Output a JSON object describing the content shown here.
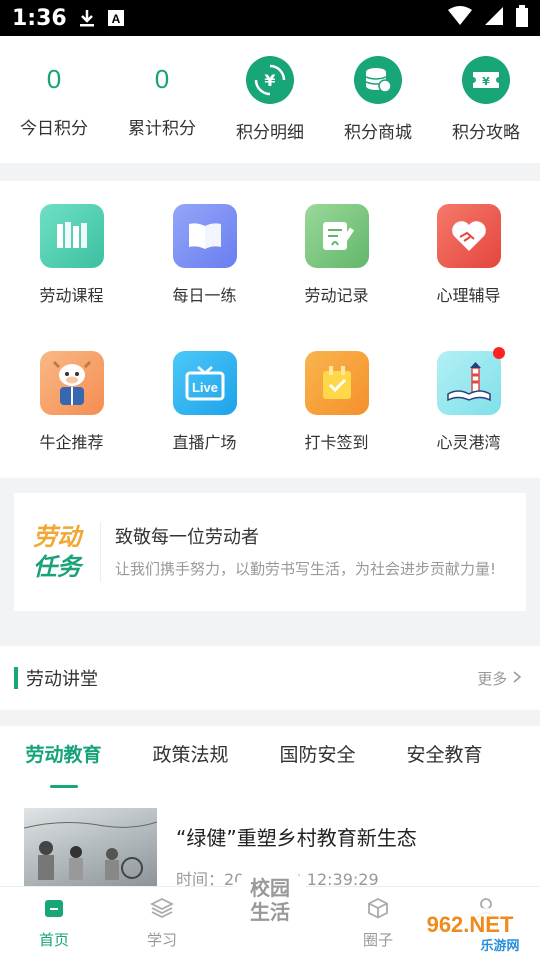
{
  "status_bar": {
    "time": "1:36"
  },
  "points": {
    "today": {
      "value": "0",
      "label": "今日积分"
    },
    "total": {
      "value": "0",
      "label": "累计积分"
    },
    "actions": [
      {
        "label": "积分明细",
        "icon": "yuan-cycle-icon"
      },
      {
        "label": "积分商城",
        "icon": "coin-stack-icon"
      },
      {
        "label": "积分攻略",
        "icon": "ticket-icon"
      }
    ]
  },
  "grid": [
    {
      "label": "劳动课程",
      "icon": "books-icon",
      "color": "#52d1b2"
    },
    {
      "label": "每日一练",
      "icon": "open-book-icon",
      "color": "#7b92f5"
    },
    {
      "label": "劳动记录",
      "icon": "notepad-pen-icon",
      "color": "#79c57e"
    },
    {
      "label": "心理辅导",
      "icon": "heart-handshake-icon",
      "color": "#ee5a4d"
    },
    {
      "label": "牛企推荐",
      "icon": "cow-mascot-icon",
      "color": "#f7a36b"
    },
    {
      "label": "直播广场",
      "icon": "live-tv-icon",
      "color": "#29b6f6"
    },
    {
      "label": "打卡签到",
      "icon": "checkin-calendar-icon",
      "color": "#f7a43a"
    },
    {
      "label": "心灵港湾",
      "icon": "lighthouse-icon",
      "color": "#9ce8ef"
    }
  ],
  "banner": {
    "badge_line1": "劳动",
    "badge_line2": "任务",
    "title": "致敬每一位劳动者",
    "subtitle": "让我们携手努力，以勤劳书写生活，为社会进步贡献力量!"
  },
  "section": {
    "title": "劳动讲堂",
    "more": "更多"
  },
  "tabs": [
    "劳动教育",
    "政策法规",
    "国防安全",
    "安全教育"
  ],
  "article": {
    "title": "“绿健”重塑乡村教育新生态",
    "time": "时间：20 -01-22 12:39:29"
  },
  "bottom_nav": [
    {
      "label": "首页",
      "icon": "home-icon",
      "active": true
    },
    {
      "label": "学习",
      "icon": "layers-icon",
      "active": false
    },
    {
      "label": "圈子",
      "icon": "cube-icon",
      "active": false
    },
    {
      "label": "",
      "icon": "user-icon",
      "active": false
    }
  ],
  "center_logo": {
    "line1": "校园",
    "line2": "生活"
  },
  "watermark": {
    "text": "962.NET",
    "sub": "乐游网"
  },
  "colors": {
    "accent": "#18a577",
    "red_dot": "#ff2222"
  }
}
